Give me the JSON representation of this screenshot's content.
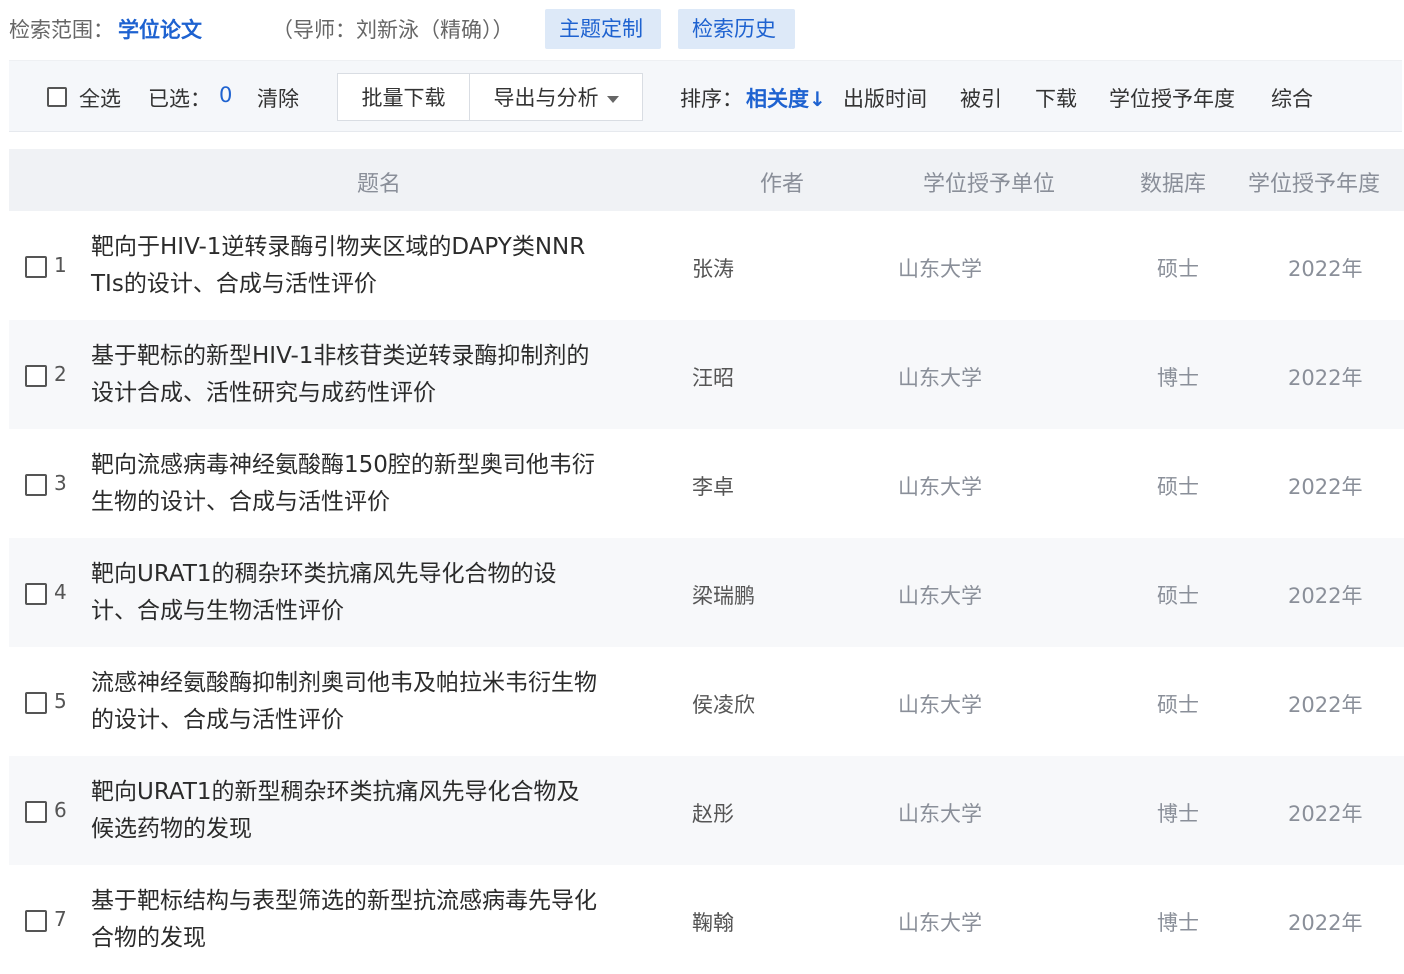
{
  "scope": {
    "label": "检索范围：",
    "value": "学位论文",
    "mentor": "（导师：刘新泳（精确））",
    "chip_theme": "主题定制",
    "chip_history": "检索历史"
  },
  "toolbar": {
    "select_all": "全选",
    "selected_label": "已选：",
    "selected_count": "0",
    "clear": "清除",
    "batch_download": "批量下载",
    "export_analyze": "导出与分析",
    "sort_label": "排序：",
    "sort_active": "相关度",
    "sort_arrow": "↓",
    "sort_publish": "出版时间",
    "sort_cited": "被引",
    "sort_download": "下载",
    "sort_degree_year": "学位授予年度",
    "sort_overall": "综合"
  },
  "table": {
    "headers": {
      "title": "题名",
      "author": "作者",
      "unit": "学位授予单位",
      "db": "数据库",
      "year": "学位授予年度"
    },
    "rows": [
      {
        "num": "1",
        "title_l1": "靶向于HIV-1逆转录酶引物夹区域的DAPY类NNR",
        "title_l2": "TIs的设计、合成与活性评价",
        "author": "张涛",
        "unit": "山东大学",
        "db": "硕士",
        "year": "2022年"
      },
      {
        "num": "2",
        "title_l1": "基于靶标的新型HIV-1非核苷类逆转录酶抑制剂的",
        "title_l2": "设计合成、活性研究与成药性评价",
        "author": "汪昭",
        "unit": "山东大学",
        "db": "博士",
        "year": "2022年"
      },
      {
        "num": "3",
        "title_l1": "靶向流感病毒神经氨酸酶150腔的新型奥司他韦衍",
        "title_l2": "生物的设计、合成与活性评价",
        "author": "李卓",
        "unit": "山东大学",
        "db": "硕士",
        "year": "2022年"
      },
      {
        "num": "4",
        "title_l1": "靶向URAT1的稠杂环类抗痛风先导化合物的设",
        "title_l2": "计、合成与生物活性评价",
        "author": "梁瑞鹏",
        "unit": "山东大学",
        "db": "硕士",
        "year": "2022年"
      },
      {
        "num": "5",
        "title_l1": "流感神经氨酸酶抑制剂奥司他韦及帕拉米韦衍生物",
        "title_l2": "的设计、合成与活性评价",
        "author": "侯凌欣",
        "unit": "山东大学",
        "db": "硕士",
        "year": "2022年"
      },
      {
        "num": "6",
        "title_l1": "靶向URAT1的新型稠杂环类抗痛风先导化合物及",
        "title_l2": "候选药物的发现",
        "author": "赵彤",
        "unit": "山东大学",
        "db": "博士",
        "year": "2022年"
      },
      {
        "num": "7",
        "title_l1": "基于靶标结构与表型筛选的新型抗流感病毒先导化",
        "title_l2": "合物的发现",
        "author": "鞠翰",
        "unit": "山东大学",
        "db": "博士",
        "year": "2022年"
      }
    ]
  }
}
